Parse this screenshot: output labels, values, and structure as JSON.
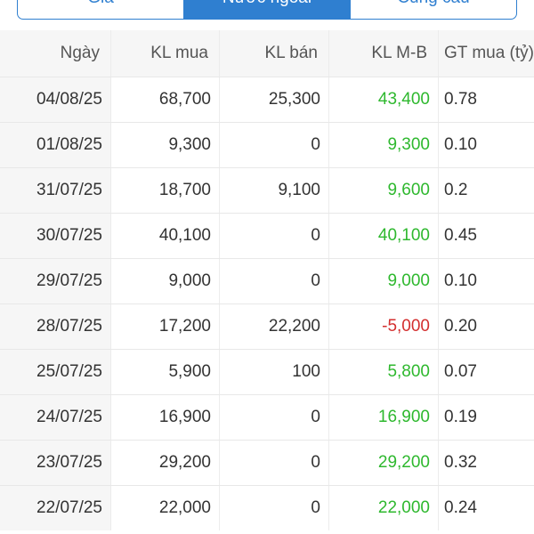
{
  "tabs": [
    {
      "label": "Giá",
      "active": false
    },
    {
      "label": "Nước ngoài",
      "active": true
    },
    {
      "label": "Cung cầu",
      "active": false
    }
  ],
  "colors": {
    "accent": "#2f7fd0",
    "positive": "#2eb82e",
    "negative": "#d32f2f"
  },
  "table": {
    "headers": [
      "Ngày",
      "KL mua",
      "KL bán",
      "KL M-B",
      "GT mua (tỷ)"
    ],
    "rows": [
      [
        "04/08/25",
        "68,700",
        "25,300",
        "43,400",
        "0.78"
      ],
      [
        "01/08/25",
        "9,300",
        "0",
        "9,300",
        "0.10"
      ],
      [
        "31/07/25",
        "18,700",
        "9,100",
        "9,600",
        "0.2"
      ],
      [
        "30/07/25",
        "40,100",
        "0",
        "40,100",
        "0.45"
      ],
      [
        "29/07/25",
        "9,000",
        "0",
        "9,000",
        "0.10"
      ],
      [
        "28/07/25",
        "17,200",
        "22,200",
        "-5,000",
        "0.20"
      ],
      [
        "25/07/25",
        "5,900",
        "100",
        "5,800",
        "0.07"
      ],
      [
        "24/07/25",
        "16,900",
        "0",
        "16,900",
        "0.19"
      ],
      [
        "23/07/25",
        "29,200",
        "0",
        "29,200",
        "0.32"
      ],
      [
        "22/07/25",
        "22,000",
        "0",
        "22,000",
        "0.24"
      ]
    ]
  }
}
